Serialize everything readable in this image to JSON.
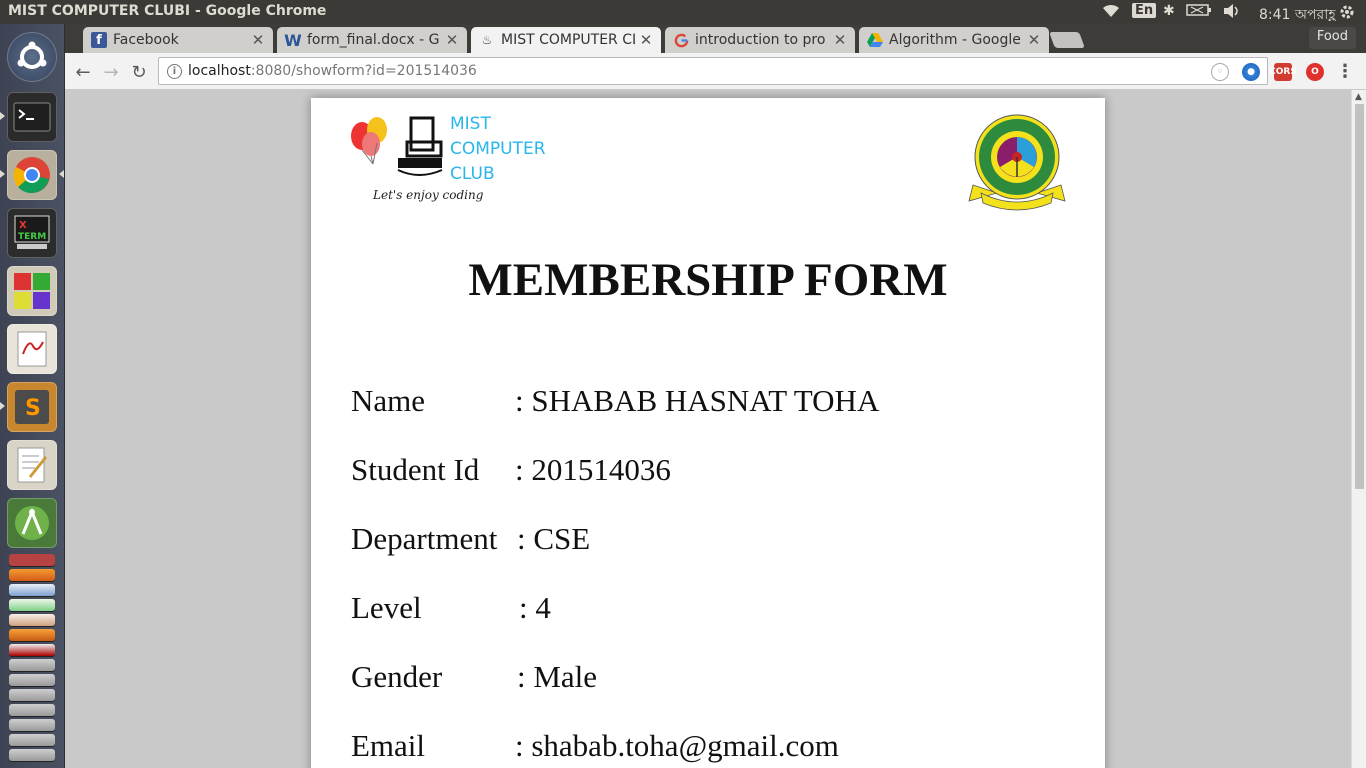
{
  "os": {
    "window_title": "MIST COMPUTER CLUBI - Google Chrome",
    "tray": {
      "language": "En",
      "clock": "8:41 অপরাহ্ণ"
    }
  },
  "browser": {
    "tabs": [
      {
        "label": "Facebook",
        "icon": "facebook-icon"
      },
      {
        "label": "form_final.docx - G",
        "icon": "word-doc-icon"
      },
      {
        "label": "MIST COMPUTER CL",
        "icon": "club-favicon",
        "active": true
      },
      {
        "label": "introduction to pro",
        "icon": "google-icon"
      },
      {
        "label": "Algorithm - Google",
        "icon": "google-drive-icon"
      }
    ],
    "profile_label": "Food",
    "url_host": "localhost",
    "url_rest": ":8080/showform?id=201514036"
  },
  "page": {
    "club_name_lines": [
      "MIST",
      "COMPUTER",
      "CLUB"
    ],
    "club_tagline": "Let's enjoy coding",
    "title": "MEMBERSHIP FORM",
    "fields": [
      {
        "label": "Name",
        "value": ": SHABAB HASNAT TOHA"
      },
      {
        "label": "Student Id",
        "value": ": 201514036"
      },
      {
        "label": "Department",
        "value": ": CSE"
      },
      {
        "label": "Level",
        "value": ": 4"
      },
      {
        "label": "Gender",
        "value": ": Male"
      },
      {
        "label": "Email",
        "value": ": shabab.toha@gmail.com"
      }
    ]
  },
  "colors": {
    "club_accent": "#29b6ea",
    "seal_green": "#2e8b3d",
    "seal_yellow": "#f3e21b"
  }
}
